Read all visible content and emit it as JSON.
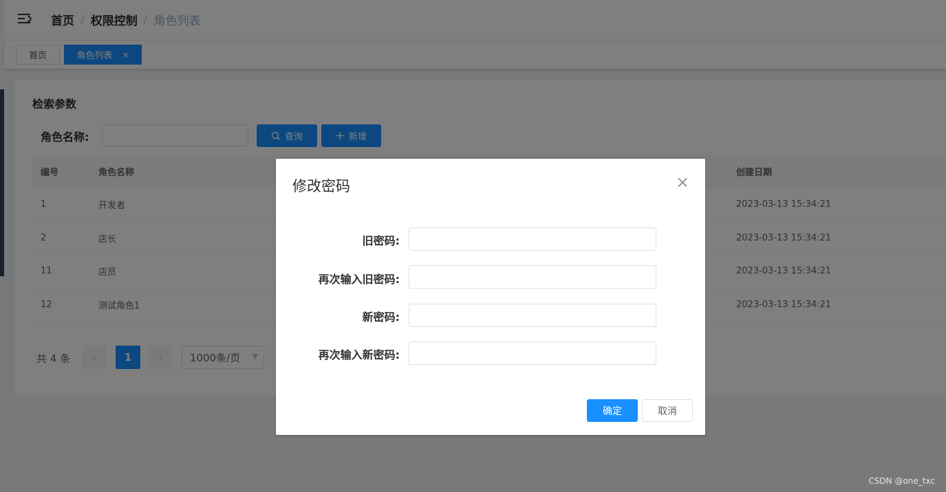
{
  "breadcrumb": [
    "首页",
    "权限控制",
    "角色列表"
  ],
  "breadcrumb_sep": "/",
  "tags": [
    {
      "label": "首页"
    },
    {
      "label": "角色列表",
      "close": "×"
    }
  ],
  "search": {
    "section_title": "检索参数",
    "role_name_label": "角色名称:",
    "role_name_value": "",
    "query_label": "查询",
    "add_label": "新增"
  },
  "table": {
    "headers": {
      "id": "编号",
      "name": "角色名称",
      "created": "创建日期"
    },
    "rows": [
      {
        "id": "1",
        "name": "开发者",
        "created": "2023-03-13 15:34:21"
      },
      {
        "id": "2",
        "name": "店长",
        "created": "2023-03-13 15:34:21"
      },
      {
        "id": "11",
        "name": "店员",
        "created": "2023-03-13 15:34:21"
      },
      {
        "id": "12",
        "name": "测试角色1",
        "created": "2023-03-13 15:34:21"
      }
    ]
  },
  "pagination": {
    "total": "共 4 条",
    "prev": "‹",
    "current_page": "1",
    "next": "›",
    "page_size": "1000条/页"
  },
  "dialog": {
    "title": "修改密码",
    "fields": [
      {
        "label": "旧密码:",
        "value": ""
      },
      {
        "label": "再次输入旧密码:",
        "value": ""
      },
      {
        "label": "新密码:",
        "value": ""
      },
      {
        "label": "再次输入新密码:",
        "value": ""
      }
    ],
    "ok_label": "确定",
    "cancel_label": "取消"
  },
  "watermark": "CSDN @one_txc",
  "colors": {
    "primary": "#1890ff",
    "sidebar": "#304156",
    "mask": "rgba(0,0,0,0.5)"
  }
}
